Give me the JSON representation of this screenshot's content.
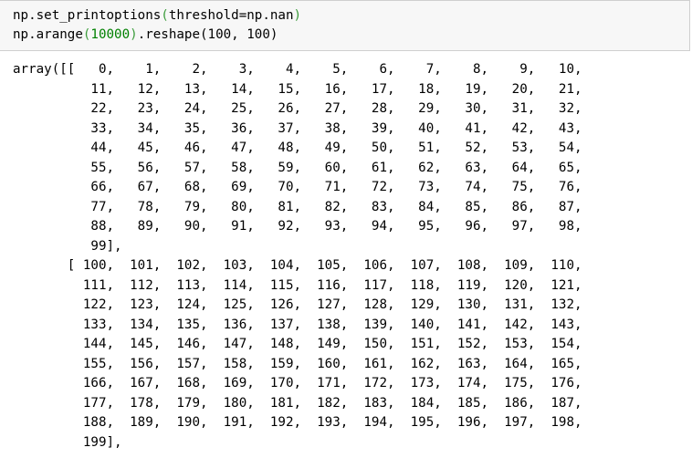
{
  "input_cell": {
    "line1": {
      "func": "np.set_printoptions",
      "open": "(",
      "args": "threshold=np.nan",
      "close": ")"
    },
    "line2": {
      "func": "np.arange",
      "open": "(",
      "num": "10000",
      "close": ")",
      "rest": ".reshape(100, 100)"
    }
  },
  "output_cell": {
    "lines": [
      "array([[   0,    1,    2,    3,    4,    5,    6,    7,    8,    9,   10,",
      "          11,   12,   13,   14,   15,   16,   17,   18,   19,   20,   21,",
      "          22,   23,   24,   25,   26,   27,   28,   29,   30,   31,   32,",
      "          33,   34,   35,   36,   37,   38,   39,   40,   41,   42,   43,",
      "          44,   45,   46,   47,   48,   49,   50,   51,   52,   53,   54,",
      "          55,   56,   57,   58,   59,   60,   61,   62,   63,   64,   65,",
      "          66,   67,   68,   69,   70,   71,   72,   73,   74,   75,   76,",
      "          77,   78,   79,   80,   81,   82,   83,   84,   85,   86,   87,",
      "          88,   89,   90,   91,   92,   93,   94,   95,   96,   97,   98,",
      "          99],",
      "       [ 100,  101,  102,  103,  104,  105,  106,  107,  108,  109,  110,",
      "         111,  112,  113,  114,  115,  116,  117,  118,  119,  120,  121,",
      "         122,  123,  124,  125,  126,  127,  128,  129,  130,  131,  132,",
      "         133,  134,  135,  136,  137,  138,  139,  140,  141,  142,  143,",
      "         144,  145,  146,  147,  148,  149,  150,  151,  152,  153,  154,",
      "         155,  156,  157,  158,  159,  160,  161,  162,  163,  164,  165,",
      "         166,  167,  168,  169,  170,  171,  172,  173,  174,  175,  176,",
      "         177,  178,  179,  180,  181,  182,  183,  184,  185,  186,  187,",
      "         188,  189,  190,  191,  192,  193,  194,  195,  196,  197,  198,",
      "         199],"
    ]
  },
  "colors": {
    "paren": "#3c9c3c",
    "number_literal": "#008000",
    "input_background": "#f7f7f7",
    "input_border": "#cfcfcf"
  }
}
